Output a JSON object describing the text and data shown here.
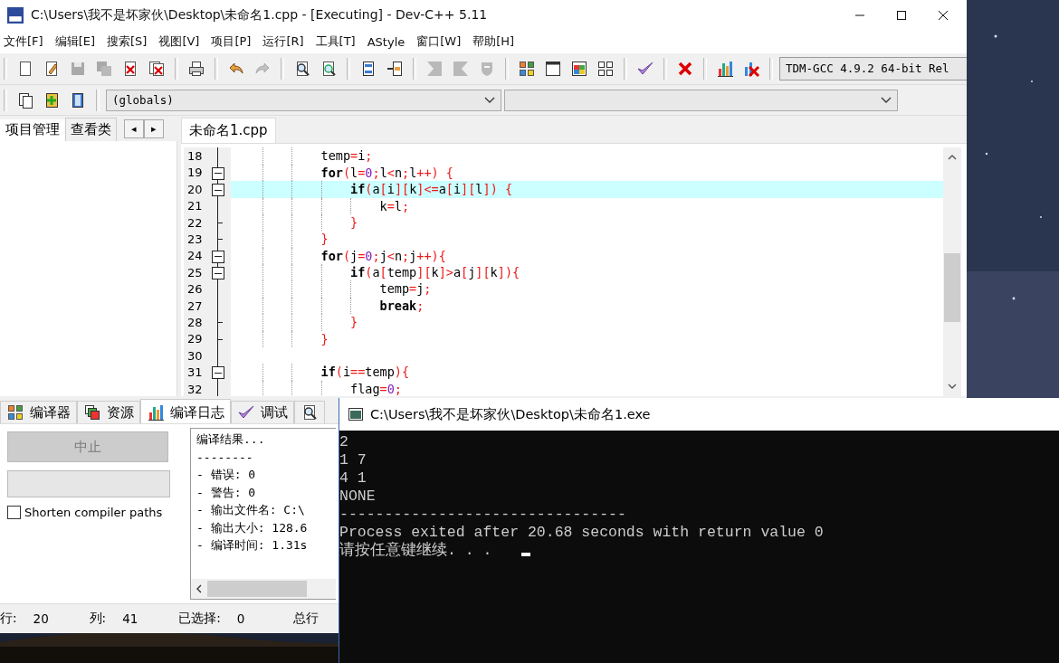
{
  "window": {
    "title": "C:\\Users\\我不是坏家伙\\Desktop\\未命名1.cpp - [Executing] - Dev-C++ 5.11"
  },
  "menu": [
    "文件[F]",
    "编辑[E]",
    "搜索[S]",
    "视图[V]",
    "项目[P]",
    "运行[R]",
    "工具[T]",
    "AStyle",
    "窗口[W]",
    "帮助[H]"
  ],
  "toolbar": [
    [
      {
        "kind": "new",
        "disabled": false
      },
      {
        "kind": "open",
        "disabled": false
      },
      {
        "kind": "save",
        "disabled": true
      },
      {
        "kind": "saveall",
        "disabled": true
      },
      {
        "kind": "close",
        "disabled": false
      },
      {
        "kind": "closeall",
        "disabled": false
      }
    ],
    [
      {
        "kind": "print",
        "disabled": false
      }
    ],
    [
      {
        "kind": "undo",
        "disabled": false
      },
      {
        "kind": "redo",
        "disabled": true
      }
    ],
    [
      {
        "kind": "find",
        "disabled": false
      },
      {
        "kind": "replace",
        "disabled": false
      }
    ],
    [
      {
        "kind": "goto",
        "disabled": false
      },
      {
        "kind": "bookmark",
        "disabled": false
      }
    ],
    [
      {
        "kind": "indent",
        "disabled": true
      },
      {
        "kind": "unindent",
        "disabled": true
      },
      {
        "kind": "comment",
        "disabled": true
      }
    ],
    [
      {
        "kind": "compile",
        "disabled": false
      },
      {
        "kind": "run",
        "disabled": false
      },
      {
        "kind": "compilerun",
        "disabled": false
      },
      {
        "kind": "rebuild",
        "disabled": false
      }
    ],
    [
      {
        "kind": "check",
        "disabled": false
      }
    ],
    [
      {
        "kind": "stop",
        "disabled": false
      }
    ],
    [
      {
        "kind": "chart",
        "disabled": false
      },
      {
        "kind": "profile",
        "disabled": false
      }
    ]
  ],
  "compiler_select": {
    "value": "TDM-GCC 4.9.2 64-bit Rel"
  },
  "toolbar2": [
    {
      "kind": "newproject",
      "disabled": false
    },
    {
      "kind": "add",
      "disabled": false
    },
    {
      "kind": "class",
      "disabled": false
    }
  ],
  "scope_select": {
    "value": "(globals)"
  },
  "left_tabs": [
    {
      "label": "项目管理",
      "selected": true
    },
    {
      "label": "查看类",
      "selected": false
    }
  ],
  "left_arrows": [
    "◂",
    "▸"
  ],
  "editor_tabs": [
    {
      "label": "未命名1.cpp",
      "selected": true
    }
  ],
  "code_lines": [
    {
      "number": "18",
      "kind": "body",
      "highlighted": false,
      "tokens": [
        {
          "kind": "id",
          "text": "            temp"
        },
        {
          "kind": "sym",
          "text": "="
        },
        {
          "kind": "id",
          "text": "i"
        },
        {
          "kind": "sym",
          "text": ";"
        }
      ]
    },
    {
      "number": "19",
      "kind": "start",
      "highlighted": false,
      "tokens": [
        {
          "kind": "kw",
          "text": "            for"
        },
        {
          "kind": "sym",
          "text": "("
        },
        {
          "kind": "id",
          "text": "l"
        },
        {
          "kind": "sym",
          "text": "="
        },
        {
          "kind": "num",
          "text": "0"
        },
        {
          "kind": "sym",
          "text": ";"
        },
        {
          "kind": "id",
          "text": "l"
        },
        {
          "kind": "sym",
          "text": "<"
        },
        {
          "kind": "id",
          "text": "n"
        },
        {
          "kind": "sym",
          "text": ";"
        },
        {
          "kind": "id",
          "text": "l"
        },
        {
          "kind": "sym",
          "text": "++) {"
        }
      ]
    },
    {
      "number": "20",
      "kind": "start",
      "highlighted": true,
      "tokens": [
        {
          "kind": "kw",
          "text": "                if"
        },
        {
          "kind": "sym",
          "text": "("
        },
        {
          "kind": "id",
          "text": "a"
        },
        {
          "kind": "sym",
          "text": "["
        },
        {
          "kind": "id",
          "text": "i"
        },
        {
          "kind": "sym",
          "text": "]["
        },
        {
          "kind": "id",
          "text": "k"
        },
        {
          "kind": "sym",
          "text": "]<="
        },
        {
          "kind": "id",
          "text": "a"
        },
        {
          "kind": "sym",
          "text": "["
        },
        {
          "kind": "id",
          "text": "i"
        },
        {
          "kind": "sym",
          "text": "]["
        },
        {
          "kind": "id",
          "text": "l"
        },
        {
          "kind": "sym",
          "text": "]) {"
        }
      ]
    },
    {
      "number": "21",
      "kind": "body",
      "highlighted": false,
      "tokens": [
        {
          "kind": "id",
          "text": "                    k"
        },
        {
          "kind": "sym",
          "text": "="
        },
        {
          "kind": "id",
          "text": "l"
        },
        {
          "kind": "sym",
          "text": ";"
        }
      ]
    },
    {
      "number": "22",
      "kind": "end",
      "highlighted": false,
      "tokens": [
        {
          "kind": "sym",
          "text": "                }"
        }
      ]
    },
    {
      "number": "23",
      "kind": "end",
      "highlighted": false,
      "tokens": [
        {
          "kind": "sym",
          "text": "            }"
        }
      ]
    },
    {
      "number": "24",
      "kind": "start",
      "highlighted": false,
      "tokens": [
        {
          "kind": "kw",
          "text": "            for"
        },
        {
          "kind": "sym",
          "text": "("
        },
        {
          "kind": "id",
          "text": "j"
        },
        {
          "kind": "sym",
          "text": "="
        },
        {
          "kind": "num",
          "text": "0"
        },
        {
          "kind": "sym",
          "text": ";"
        },
        {
          "kind": "id",
          "text": "j"
        },
        {
          "kind": "sym",
          "text": "<"
        },
        {
          "kind": "id",
          "text": "n"
        },
        {
          "kind": "sym",
          "text": ";"
        },
        {
          "kind": "id",
          "text": "j"
        },
        {
          "kind": "sym",
          "text": "++){"
        }
      ]
    },
    {
      "number": "25",
      "kind": "start",
      "highlighted": false,
      "tokens": [
        {
          "kind": "kw",
          "text": "                if"
        },
        {
          "kind": "sym",
          "text": "("
        },
        {
          "kind": "id",
          "text": "a"
        },
        {
          "kind": "sym",
          "text": "["
        },
        {
          "kind": "id",
          "text": "temp"
        },
        {
          "kind": "sym",
          "text": "]["
        },
        {
          "kind": "id",
          "text": "k"
        },
        {
          "kind": "sym",
          "text": "]>"
        },
        {
          "kind": "id",
          "text": "a"
        },
        {
          "kind": "sym",
          "text": "["
        },
        {
          "kind": "id",
          "text": "j"
        },
        {
          "kind": "sym",
          "text": "]["
        },
        {
          "kind": "id",
          "text": "k"
        },
        {
          "kind": "sym",
          "text": "]){"
        }
      ]
    },
    {
      "number": "26",
      "kind": "body",
      "highlighted": false,
      "tokens": [
        {
          "kind": "id",
          "text": "                    temp"
        },
        {
          "kind": "sym",
          "text": "="
        },
        {
          "kind": "id",
          "text": "j"
        },
        {
          "kind": "sym",
          "text": ";"
        }
      ]
    },
    {
      "number": "27",
      "kind": "body",
      "highlighted": false,
      "tokens": [
        {
          "kind": "kw",
          "text": "                    break"
        },
        {
          "kind": "sym",
          "text": ";"
        }
      ]
    },
    {
      "number": "28",
      "kind": "end",
      "highlighted": false,
      "tokens": [
        {
          "kind": "sym",
          "text": "                }"
        }
      ]
    },
    {
      "number": "29",
      "kind": "end",
      "highlighted": false,
      "tokens": [
        {
          "kind": "sym",
          "text": "            }"
        }
      ]
    },
    {
      "number": "30",
      "kind": "body",
      "highlighted": false
    },
    {
      "number": "31",
      "kind": "start",
      "highlighted": false,
      "tokens": [
        {
          "kind": "kw",
          "text": "            if"
        },
        {
          "kind": "sym",
          "text": "("
        },
        {
          "kind": "id",
          "text": "i"
        },
        {
          "kind": "sym",
          "text": "=="
        },
        {
          "kind": "id",
          "text": "temp"
        },
        {
          "kind": "sym",
          "text": "){"
        }
      ]
    },
    {
      "number": "32",
      "kind": "body",
      "highlighted": false,
      "tokens": [
        {
          "kind": "id",
          "text": "                flag"
        },
        {
          "kind": "sym",
          "text": "="
        },
        {
          "kind": "num",
          "text": "0"
        },
        {
          "kind": "sym",
          "text": ";"
        }
      ]
    }
  ],
  "bottom_tabs": [
    {
      "kind": "compile",
      "label": "编译器",
      "selected": false
    },
    {
      "kind": "resources",
      "label": "资源",
      "selected": false
    },
    {
      "kind": "chart",
      "label": "编译日志",
      "selected": true
    },
    {
      "kind": "check",
      "label": "调试",
      "selected": false
    },
    {
      "kind": "find",
      "selected": false
    }
  ],
  "abort_button": {
    "label": "中止",
    "disabled": true
  },
  "progress": {
    "level": 0
  },
  "shorten_paths": {
    "label": "Shorten compiler paths",
    "checked": false
  },
  "compile_log": [
    "编译结果...",
    "--------",
    "- 错误: 0",
    "- 警告: 0",
    "- 输出文件名: C:\\",
    "- 输出大小: 128.6",
    "- 编译时间: 1.31s"
  ],
  "status_bar": [
    {
      "label": "行:",
      "value": "20"
    },
    {
      "label": "列:",
      "value": "41"
    },
    {
      "label": "已选择:",
      "value": "0"
    },
    {
      "label": "总行"
    }
  ],
  "console": {
    "title": "C:\\Users\\我不是坏家伙\\Desktop\\未命名1.exe",
    "lines": [
      "2",
      "1 7",
      "4 1",
      "NONE",
      "--------------------------------",
      "Process exited after 20.68 seconds with return value 0",
      "请按任意键继续. . . "
    ],
    "cursor": true
  }
}
